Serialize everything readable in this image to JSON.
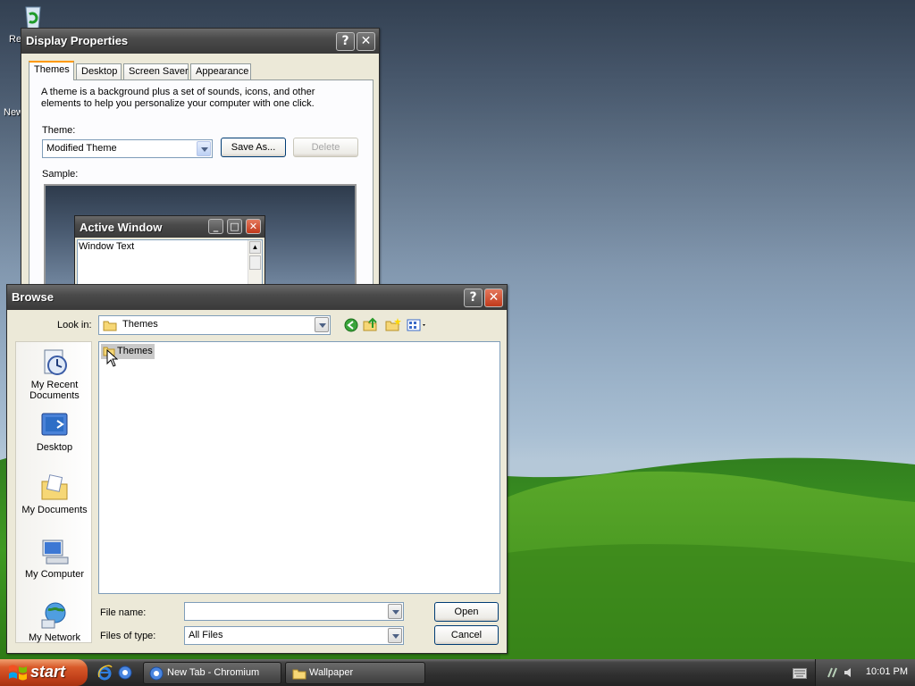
{
  "desktop": {
    "icons": [
      {
        "label": "Re"
      },
      {
        "label": "New"
      }
    ]
  },
  "display_properties": {
    "title": "Display Properties",
    "tabs": [
      {
        "label": "Themes",
        "active": true
      },
      {
        "label": "Desktop"
      },
      {
        "label": "Screen Saver"
      },
      {
        "label": "Appearance"
      }
    ],
    "description": "A theme is a background plus a set of sounds, icons, and other elements to help you personalize your computer with one click.",
    "theme_label": "Theme:",
    "theme_value": "Modified Theme",
    "save_as_label": "Save As...",
    "delete_label": "Delete",
    "sample_label": "Sample:",
    "sample_window": {
      "title": "Active Window",
      "text": "Window Text"
    }
  },
  "browse": {
    "title": "Browse",
    "look_in_label": "Look in:",
    "look_in_value": "Themes",
    "places": [
      {
        "label": "My Recent Documents",
        "icon": "recent-documents-icon"
      },
      {
        "label": "Desktop",
        "icon": "desktop-icon"
      },
      {
        "label": "My Documents",
        "icon": "my-documents-icon"
      },
      {
        "label": "My Computer",
        "icon": "my-computer-icon"
      },
      {
        "label": "My Network",
        "icon": "my-network-icon"
      }
    ],
    "files": [
      {
        "name": "Themes",
        "icon": "folder-icon"
      }
    ],
    "file_name_label": "File name:",
    "file_name_value": "",
    "files_of_type_label": "Files of type:",
    "files_of_type_value": "All Files",
    "open_label": "Open",
    "cancel_label": "Cancel"
  },
  "taskbar": {
    "start_label": "start",
    "tasks": [
      {
        "label": "New Tab - Chromium",
        "icon": "chromium-icon"
      },
      {
        "label": "Wallpaper",
        "icon": "folder-icon"
      }
    ],
    "clock": "10:01 PM"
  },
  "colors": {
    "start_button": "#c1401a",
    "titlebar": "#4a4a4a",
    "window_face": "#ece9d8",
    "active_tab_accent": "#ff9900"
  }
}
